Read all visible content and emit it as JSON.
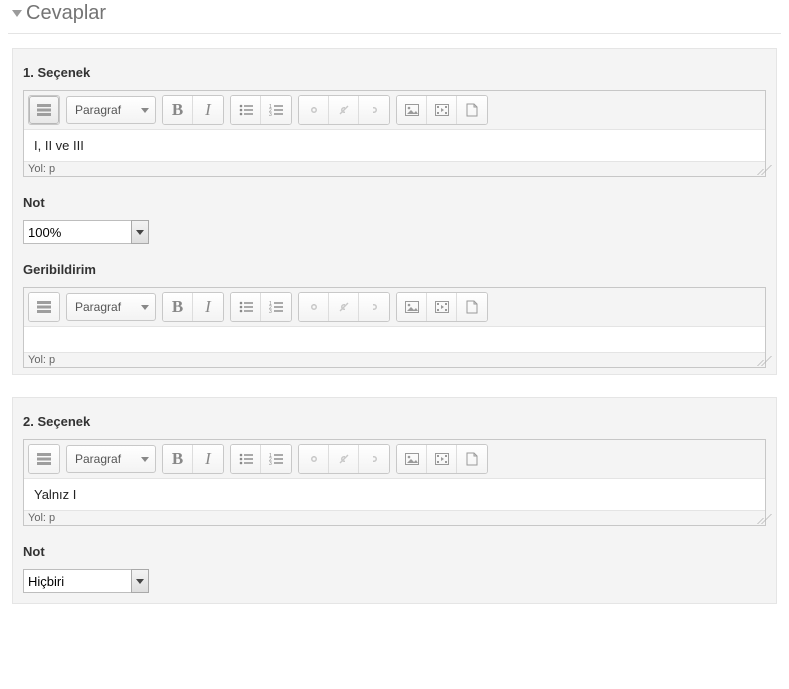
{
  "section_title": "Cevaplar",
  "toolbar": {
    "format_label": "Paragraf"
  },
  "path_prefix": "Yol: p",
  "options": [
    {
      "heading": "1. Seçenek",
      "content": "I, II ve III",
      "grade_label": "Not",
      "grade_value": "100%",
      "feedback_label": "Geribildirim",
      "feedback_content": ""
    },
    {
      "heading": "2. Seçenek",
      "content": "Yalnız I",
      "grade_label": "Not",
      "grade_value": "Hiçbiri"
    }
  ]
}
